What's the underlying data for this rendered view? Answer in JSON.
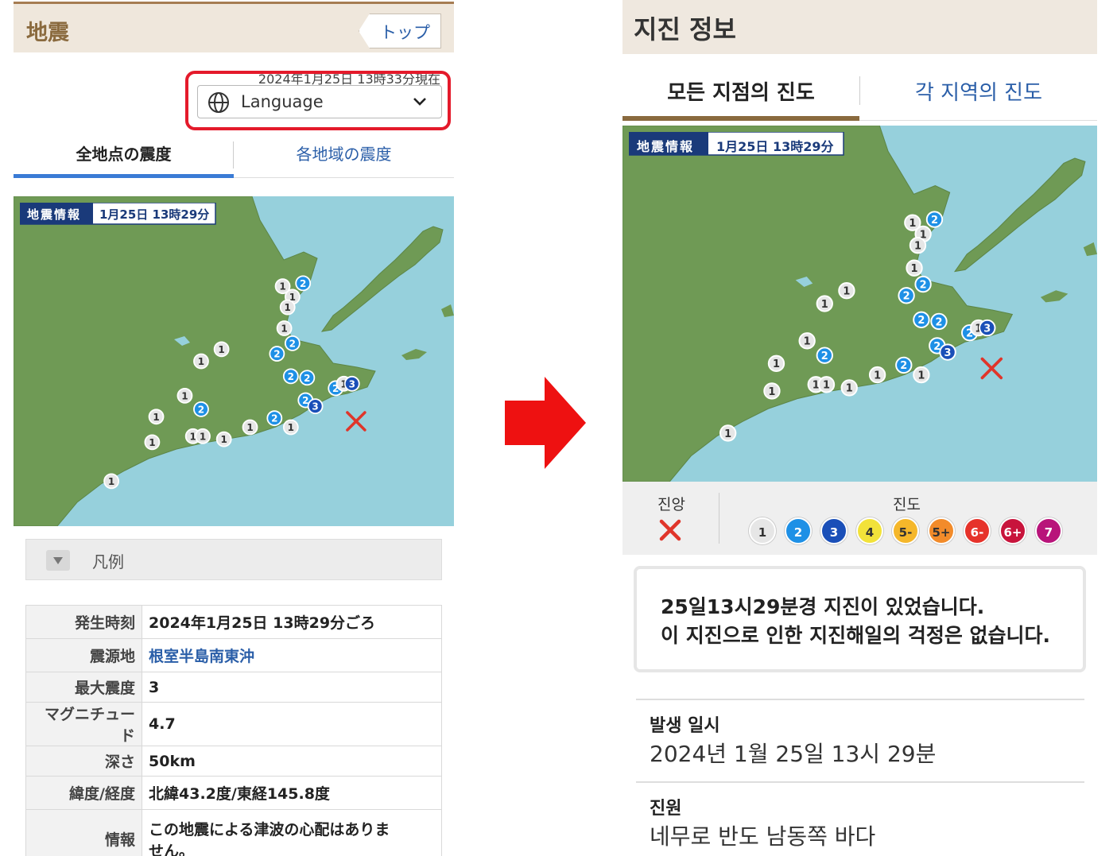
{
  "left_panel": {
    "header": {
      "title": "地震",
      "top_button": "トップ"
    },
    "timestamp": "2024年1月25日 13時33分現在",
    "language_select": {
      "label": "Language"
    },
    "tabs": [
      {
        "label": "全地点の震度",
        "active": true
      },
      {
        "label": "各地域の震度",
        "active": false
      }
    ],
    "map_badge": {
      "left": "地震情報",
      "right": "1月25日 13時29分"
    },
    "legend": {
      "label": "凡例"
    },
    "details": [
      {
        "key": "発生時刻",
        "value": "2024年1月25日 13時29分ごろ"
      },
      {
        "key": "震源地",
        "value": "根室半島南東沖"
      },
      {
        "key": "最大震度",
        "value": "3"
      },
      {
        "key": "マグニチュード",
        "value": "4.7"
      },
      {
        "key": "深さ",
        "value": "50km"
      },
      {
        "key": "緯度/経度",
        "value": "北緯43.2度/東経145.8度"
      },
      {
        "key": "情報",
        "value_line1": "この地震による津波の心配はありま",
        "value_line2": "せん。"
      }
    ]
  },
  "right_panel": {
    "header": {
      "title": "지진 정보"
    },
    "tabs": [
      {
        "label": "모든 지점의 진도",
        "active": true
      },
      {
        "label": "각 지역의 진도",
        "active": false
      }
    ],
    "map_badge": {
      "left": "地震情報",
      "right": "1月25日 13時29分"
    },
    "legend": {
      "epicenter_label": "진앙",
      "intensity_label": "진도",
      "intensities": [
        {
          "label": "1",
          "color": "#e6e6e6",
          "text_color": "#333333"
        },
        {
          "label": "2",
          "color": "#1e90e6",
          "text_color": "#ffffff"
        },
        {
          "label": "3",
          "color": "#1a4fb8",
          "text_color": "#ffffff"
        },
        {
          "label": "4",
          "color": "#f2e23a",
          "text_color": "#333333"
        },
        {
          "label": "5-",
          "color": "#f5b72a",
          "text_color": "#333333"
        },
        {
          "label": "5+",
          "color": "#f28b2a",
          "text_color": "#333333"
        },
        {
          "label": "6-",
          "color": "#e6322a",
          "text_color": "#ffffff"
        },
        {
          "label": "6+",
          "color": "#c8143c",
          "text_color": "#ffffff"
        },
        {
          "label": "7",
          "color": "#b8147a",
          "text_color": "#ffffff"
        }
      ]
    },
    "message": {
      "line1": "25일13시29분경 지진이 있었습니다.",
      "line2": "이 지진으로 인한 지진해일의 걱정은 없습니다."
    },
    "fields": [
      {
        "key": "발생 일시",
        "value": "2024년 1월 25일 13시 29분"
      },
      {
        "key": "진원",
        "value": "네무로 반도 남동쪽 바다"
      }
    ]
  },
  "map_markers": [
    {
      "i": "1",
      "lon": 144.9,
      "lat": 44.1
    },
    {
      "i": "2",
      "lon": 145.15,
      "lat": 44.12
    },
    {
      "i": "1",
      "lon": 145.02,
      "lat": 44.03
    },
    {
      "i": "1",
      "lon": 144.96,
      "lat": 43.96
    },
    {
      "i": "1",
      "lon": 144.92,
      "lat": 43.82
    },
    {
      "i": "2",
      "lon": 145.02,
      "lat": 43.72
    },
    {
      "i": "2",
      "lon": 144.83,
      "lat": 43.65
    },
    {
      "i": "1",
      "lon": 144.15,
      "lat": 43.68
    },
    {
      "i": "1",
      "lon": 143.9,
      "lat": 43.6
    },
    {
      "i": "2",
      "lon": 145.0,
      "lat": 43.5
    },
    {
      "i": "2",
      "lon": 145.2,
      "lat": 43.49
    },
    {
      "i": "2",
      "lon": 145.18,
      "lat": 43.34
    },
    {
      "i": "2",
      "lon": 145.55,
      "lat": 43.42
    },
    {
      "i": "1",
      "lon": 145.65,
      "lat": 43.45
    },
    {
      "i": "3",
      "lon": 145.75,
      "lat": 43.45
    },
    {
      "i": "3",
      "lon": 145.3,
      "lat": 43.3
    },
    {
      "i": "1",
      "lon": 143.7,
      "lat": 43.37
    },
    {
      "i": "2",
      "lon": 143.9,
      "lat": 43.28
    },
    {
      "i": "1",
      "lon": 143.35,
      "lat": 43.23
    },
    {
      "i": "1",
      "lon": 143.3,
      "lat": 43.06
    },
    {
      "i": "1",
      "lon": 143.8,
      "lat": 43.1
    },
    {
      "i": "1",
      "lon": 143.92,
      "lat": 43.1
    },
    {
      "i": "1",
      "lon": 144.18,
      "lat": 43.08
    },
    {
      "i": "1",
      "lon": 144.5,
      "lat": 43.16
    },
    {
      "i": "2",
      "lon": 144.8,
      "lat": 43.22
    },
    {
      "i": "1",
      "lon": 145.0,
      "lat": 43.16
    },
    {
      "i": "1",
      "lon": 142.8,
      "lat": 42.8
    }
  ],
  "map_epicenter": {
    "lon": 145.8,
    "lat": 43.2
  }
}
